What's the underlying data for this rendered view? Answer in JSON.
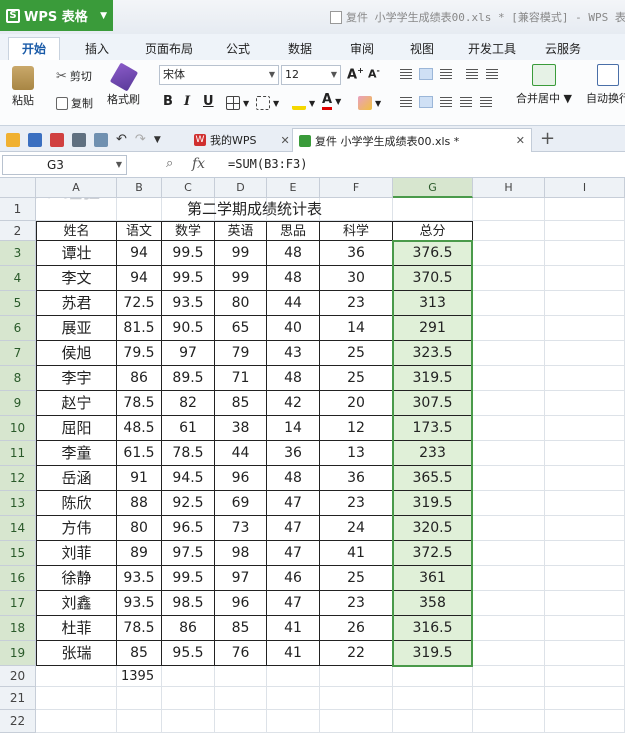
{
  "app": {
    "name": "WPS 表格",
    "window_title": "复件 小学学生成绩表00.xls * [兼容模式] - WPS 表"
  },
  "ribbon": {
    "tabs": [
      "开始",
      "插入",
      "页面布局",
      "公式",
      "数据",
      "审阅",
      "视图",
      "开发工具",
      "云服务"
    ],
    "active_tab": "开始",
    "paste_label": "粘贴",
    "cut_label": "剪切",
    "copy_label": "复制",
    "format_painter_label": "格式刷",
    "font_name": "宋体",
    "font_size": "12",
    "merge_center_label": "合并居中",
    "auto_wrap_label": "自动换行"
  },
  "doc_tabs": [
    {
      "label": "我的WPS",
      "active": false
    },
    {
      "label": "复件 小学学生成绩表00.xls *",
      "active": true
    }
  ],
  "formula_bar": {
    "cell_ref": "G3",
    "fx": "fx",
    "formula": "=SUM(B3:F3)"
  },
  "sheet": {
    "columns": [
      "A",
      "B",
      "C",
      "D",
      "E",
      "F",
      "G",
      "H",
      "I"
    ],
    "selected_column": "G",
    "title": "第二学期成绩统计表",
    "headers": [
      "姓名",
      "语文",
      "数学",
      "英语",
      "思品",
      "科学",
      "总分"
    ],
    "rows": [
      [
        "谭壮",
        "94",
        "99.5",
        "99",
        "48",
        "36",
        "376.5"
      ],
      [
        "李文",
        "94",
        "99.5",
        "99",
        "48",
        "30",
        "370.5"
      ],
      [
        "苏君",
        "72.5",
        "93.5",
        "80",
        "44",
        "23",
        "313"
      ],
      [
        "展亚",
        "81.5",
        "90.5",
        "65",
        "40",
        "14",
        "291"
      ],
      [
        "侯旭",
        "79.5",
        "97",
        "79",
        "43",
        "25",
        "323.5"
      ],
      [
        "李宇",
        "86",
        "89.5",
        "71",
        "48",
        "25",
        "319.5"
      ],
      [
        "赵宁",
        "78.5",
        "82",
        "85",
        "42",
        "20",
        "307.5"
      ],
      [
        "屈阳",
        "48.5",
        "61",
        "38",
        "14",
        "12",
        "173.5"
      ],
      [
        "李童",
        "61.5",
        "78.5",
        "44",
        "36",
        "13",
        "233"
      ],
      [
        "岳涵",
        "91",
        "94.5",
        "96",
        "48",
        "36",
        "365.5"
      ],
      [
        "陈欣",
        "88",
        "92.5",
        "69",
        "47",
        "23",
        "319.5"
      ],
      [
        "方伟",
        "80",
        "96.5",
        "73",
        "47",
        "24",
        "320.5"
      ],
      [
        "刘菲",
        "89",
        "97.5",
        "98",
        "47",
        "41",
        "372.5"
      ],
      [
        "徐静",
        "93.5",
        "99.5",
        "97",
        "46",
        "25",
        "361"
      ],
      [
        "刘鑫",
        "93.5",
        "98.5",
        "96",
        "47",
        "23",
        "358"
      ],
      [
        "杜菲",
        "78.5",
        "86",
        "85",
        "41",
        "26",
        "316.5"
      ],
      [
        "张瑞",
        "85",
        "95.5",
        "76",
        "41",
        "22",
        "319.5"
      ]
    ],
    "total_row_value": "1395",
    "row_numbers": [
      "1",
      "2",
      "3",
      "4",
      "5",
      "6",
      "7",
      "8",
      "9",
      "10",
      "11",
      "12",
      "13",
      "14",
      "15",
      "16",
      "17",
      "18",
      "19",
      "20",
      "21",
      "22"
    ]
  },
  "watermark": "Baidu 经验",
  "colors": {
    "wps_green": "#3a9b3a",
    "selection": "#4a9a4a",
    "selection_fill": "#e0f0d8"
  }
}
